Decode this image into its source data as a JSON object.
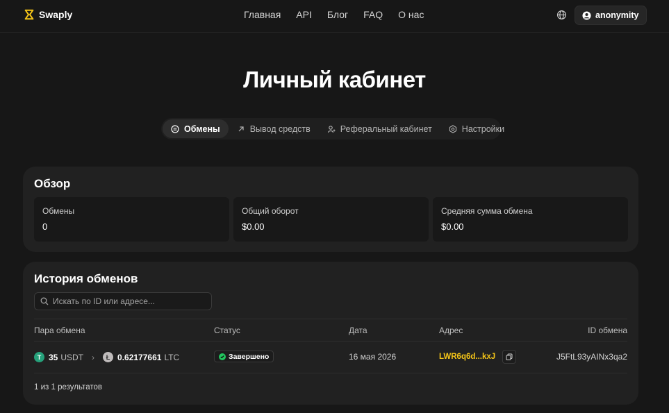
{
  "header": {
    "brand": "Swaply",
    "nav": [
      "Главная",
      "API",
      "Блог",
      "FAQ",
      "О нас"
    ],
    "user": "anonymity"
  },
  "title": "Личный кабинет",
  "tabs": [
    {
      "label": "Обмены",
      "icon": "exchange-icon",
      "active": true
    },
    {
      "label": "Вывод средств",
      "icon": "arrow-up-right-icon",
      "active": false
    },
    {
      "label": "Реферальный кабинет",
      "icon": "user-plus-icon",
      "active": false
    },
    {
      "label": "Настройки",
      "icon": "gear-icon",
      "active": false
    }
  ],
  "overview": {
    "title": "Обзор",
    "stats": [
      {
        "label": "Обмены",
        "value": "0"
      },
      {
        "label": "Общий оборот",
        "value": "$0.00"
      },
      {
        "label": "Средняя сумма обмена",
        "value": "$0.00"
      }
    ]
  },
  "history": {
    "title": "История обменов",
    "search_placeholder": "Искать по ID или адресе...",
    "columns": [
      "Пара обмена",
      "Статус",
      "Дата",
      "Адрес",
      "ID обмена"
    ],
    "rows": [
      {
        "from_amount": "35",
        "from_ticker": "USDT",
        "to_amount": "0.62177661",
        "to_ticker": "LTC",
        "status": "Завершено",
        "date": "16 мая 2026",
        "address": "LWR6q6d...kxJ",
        "id": "J5FtL93yAINx3qa2"
      }
    ],
    "results": "1 из 1 результатов"
  },
  "colors": {
    "background": "#171717",
    "card": "#212121",
    "accent": "#f5c518",
    "success": "#22c55e",
    "usdt": "#26a17b",
    "ltc": "#bfbbbb"
  }
}
